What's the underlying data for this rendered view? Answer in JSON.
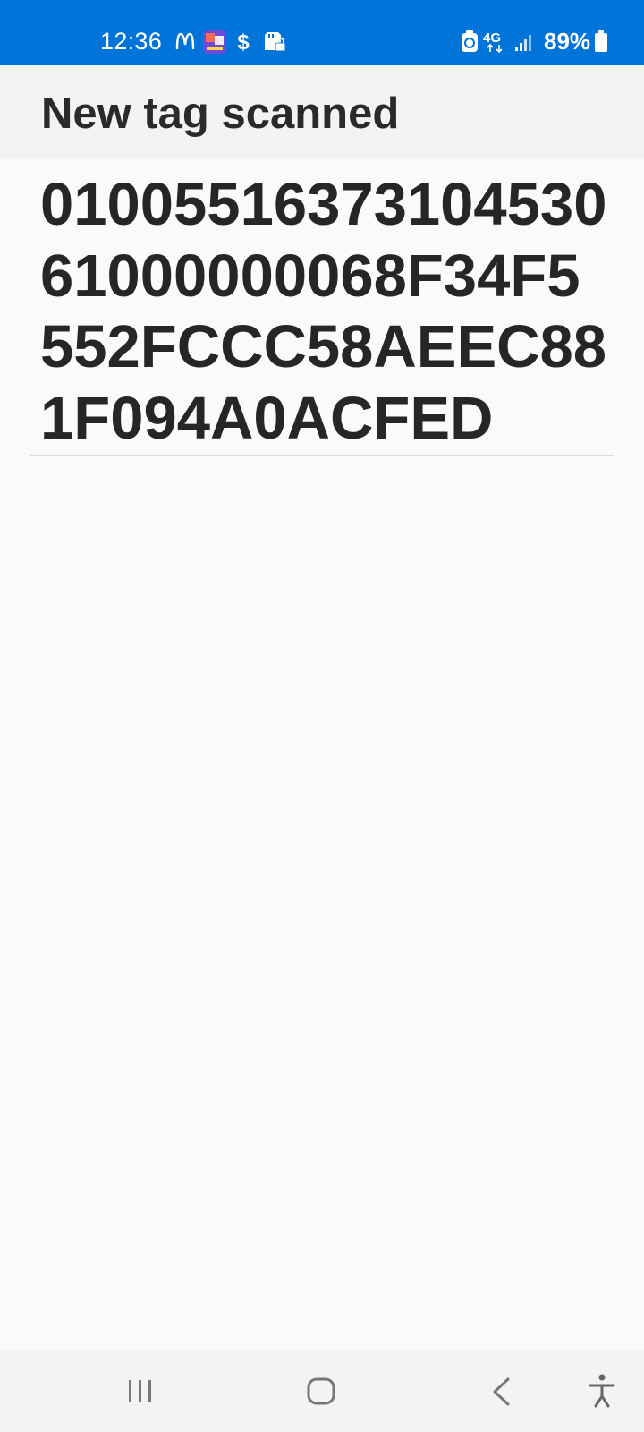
{
  "status_bar": {
    "time": "12:36",
    "battery_percent": "89%",
    "network": "4G",
    "icons": [
      "mcdonalds-icon",
      "translate-app-icon",
      "dollar-icon",
      "sd-card-lock-icon",
      "data-saver-icon",
      "network-4g-icon",
      "signal-icon",
      "battery-icon"
    ],
    "background_color": "#0074d9"
  },
  "header": {
    "title": "New tag scanned"
  },
  "tag": {
    "value": "0100551637310453061000000068F34F5552FCCC58AEEC881F094A0ACFED"
  },
  "navigation": {
    "buttons": [
      "recent-apps",
      "home",
      "back",
      "accessibility"
    ]
  }
}
